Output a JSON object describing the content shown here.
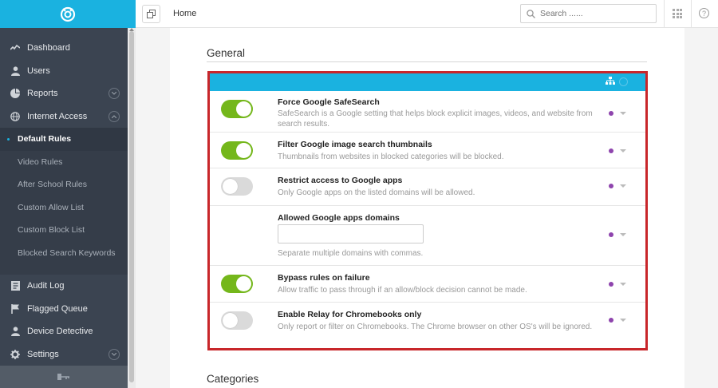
{
  "sidebar": {
    "main_items": [
      {
        "label": "Dashboard",
        "icon": "activity-icon"
      },
      {
        "label": "Users",
        "icon": "user-icon"
      },
      {
        "label": "Reports",
        "icon": "pie-chart-icon"
      },
      {
        "label": "Internet Access",
        "icon": "globe-icon"
      }
    ],
    "sub_items": [
      {
        "label": "Default Rules",
        "active": true
      },
      {
        "label": "Video Rules"
      },
      {
        "label": "After School Rules"
      },
      {
        "label": "Custom Allow List"
      },
      {
        "label": "Custom Block List"
      },
      {
        "label": "Blocked Search Keywords"
      }
    ],
    "lower_items": [
      {
        "label": "Audit Log",
        "icon": "log-icon"
      },
      {
        "label": "Flagged Queue",
        "icon": "flag-icon"
      },
      {
        "label": "Device Detective",
        "icon": "user-icon"
      },
      {
        "label": "Settings",
        "icon": "gear-icon"
      }
    ]
  },
  "topbar": {
    "breadcrumb": "Home",
    "search_placeholder": "Search ......"
  },
  "main": {
    "section_title": "General",
    "next_section_title": "Categories",
    "rows": [
      {
        "title": "Force Google SafeSearch",
        "desc": "SafeSearch is a Google setting that helps block explicit images, videos, and website from search results.",
        "toggle": "on"
      },
      {
        "title": "Filter Google image search thumbnails",
        "desc": "Thumbnails from websites in blocked categories will be blocked.",
        "toggle": "on"
      },
      {
        "title": "Restrict access to Google apps",
        "desc": "Only Google apps on the listed domains will be allowed.",
        "toggle": "off"
      },
      {
        "title": "Allowed Google apps domains",
        "desc": "Separate multiple domains with commas.",
        "input_value": ""
      },
      {
        "title": "Bypass rules on failure",
        "desc": "Allow traffic to pass through if an allow/block decision cannot be made.",
        "toggle": "on"
      },
      {
        "title": "Enable Relay for Chromebooks only",
        "desc": "Only report or filter on Chromebooks. The Chrome browser on other OS's will be ignored.",
        "toggle": "off"
      }
    ]
  },
  "colors": {
    "brand": "#1ab2e0",
    "sidebar_bg": "#3b4451",
    "toggle_on": "#74b71b",
    "highlight_border": "#c8262a",
    "status_dot": "#8e44ad"
  }
}
